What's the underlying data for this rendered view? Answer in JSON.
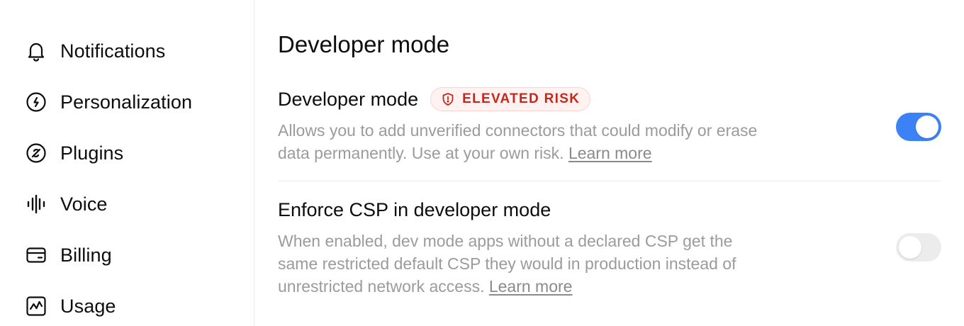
{
  "sidebar": {
    "items": [
      {
        "label": "Notifications",
        "icon": "bell-icon"
      },
      {
        "label": "Personalization",
        "icon": "personalization-icon"
      },
      {
        "label": "Plugins",
        "icon": "plugins-icon"
      },
      {
        "label": "Voice",
        "icon": "waveform-icon"
      },
      {
        "label": "Billing",
        "icon": "credit-card-icon"
      },
      {
        "label": "Usage",
        "icon": "chart-icon"
      }
    ]
  },
  "main": {
    "title": "Developer mode",
    "settings": [
      {
        "title": "Developer mode",
        "badge": "ELEVATED RISK",
        "badge_icon": "shield-alert-icon",
        "description": "Allows you to add unverified connectors that could modify or erase data permanently. Use at your own risk.",
        "learn_more": "Learn more",
        "enabled": true
      },
      {
        "title": "Enforce CSP in developer mode",
        "description": "When enabled, dev mode apps without a declared CSP get the same restricted default CSP they would in production instead of unrestricted network access.",
        "learn_more": "Learn more",
        "enabled": false
      }
    ]
  },
  "colors": {
    "accent": "#3b82f6",
    "risk": "#c4281c",
    "risk_bg": "#fff2f0",
    "muted_text": "#9b9b9b"
  }
}
